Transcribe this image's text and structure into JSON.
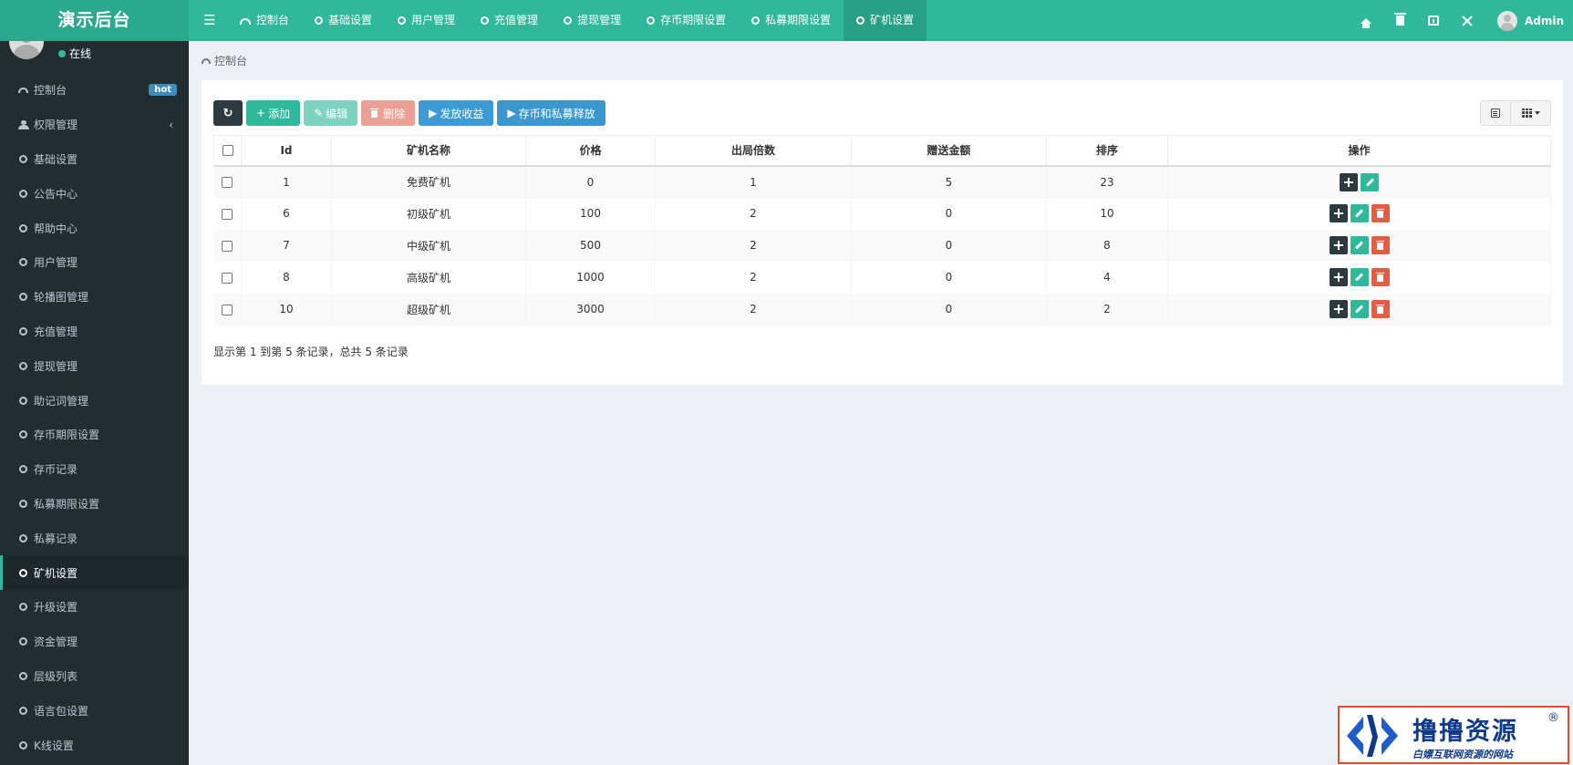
{
  "app": {
    "title": "演示后台"
  },
  "top_nav": [
    {
      "label": "控制台",
      "icon": "dashboard-icon"
    },
    {
      "label": "基础设置",
      "icon": "circle-icon"
    },
    {
      "label": "用户管理",
      "icon": "circle-icon"
    },
    {
      "label": "充值管理",
      "icon": "circle-icon"
    },
    {
      "label": "提现管理",
      "icon": "circle-icon"
    },
    {
      "label": "存币期限设置",
      "icon": "circle-icon"
    },
    {
      "label": "私募期限设置",
      "icon": "circle-icon"
    },
    {
      "label": "矿机设置",
      "icon": "circle-icon",
      "active": true
    }
  ],
  "top_right": {
    "user_name": "Admin"
  },
  "user_panel": {
    "status": "在线"
  },
  "sidebar": {
    "hot_badge": "hot",
    "items": [
      {
        "label": "控制台",
        "icon": "dashboard-icon"
      },
      {
        "label": "权限管理",
        "icon": "users-icon"
      },
      {
        "label": "基础设置",
        "icon": "circle-icon"
      },
      {
        "label": "公告中心",
        "icon": "circle-icon"
      },
      {
        "label": "帮助中心",
        "icon": "circle-icon"
      },
      {
        "label": "用户管理",
        "icon": "circle-icon"
      },
      {
        "label": "轮播图管理",
        "icon": "circle-icon"
      },
      {
        "label": "充值管理",
        "icon": "circle-icon"
      },
      {
        "label": "提现管理",
        "icon": "circle-icon"
      },
      {
        "label": "助记词管理",
        "icon": "circle-icon"
      },
      {
        "label": "存币期限设置",
        "icon": "circle-icon"
      },
      {
        "label": "存币记录",
        "icon": "circle-icon"
      },
      {
        "label": "私募期限设置",
        "icon": "circle-icon"
      },
      {
        "label": "私募记录",
        "icon": "circle-icon"
      },
      {
        "label": "矿机设置",
        "icon": "circle-icon",
        "active": true
      },
      {
        "label": "升级设置",
        "icon": "circle-icon"
      },
      {
        "label": "资金管理",
        "icon": "circle-icon"
      },
      {
        "label": "层级列表",
        "icon": "circle-icon"
      },
      {
        "label": "语言包设置",
        "icon": "circle-icon"
      },
      {
        "label": "K线设置",
        "icon": "circle-icon"
      }
    ]
  },
  "breadcrumb": {
    "label": "控制台"
  },
  "toolbar": {
    "add": "添加",
    "edit": "编辑",
    "delete": "删除",
    "release_income": "发放收益",
    "release_deposit": "存币和私募释放"
  },
  "table": {
    "headers": [
      "Id",
      "矿机名称",
      "价格",
      "出局倍数",
      "赠送金额",
      "排序",
      "操作"
    ],
    "rows": [
      {
        "id": "1",
        "name": "免费矿机",
        "price": "0",
        "multiple": "1",
        "bonus": "5",
        "sort": "23",
        "deletable": false
      },
      {
        "id": "6",
        "name": "初级矿机",
        "price": "100",
        "multiple": "2",
        "bonus": "0",
        "sort": "10",
        "deletable": true
      },
      {
        "id": "7",
        "name": "中级矿机",
        "price": "500",
        "multiple": "2",
        "bonus": "0",
        "sort": "8",
        "deletable": true
      },
      {
        "id": "8",
        "name": "高级矿机",
        "price": "1000",
        "multiple": "2",
        "bonus": "0",
        "sort": "4",
        "deletable": true
      },
      {
        "id": "10",
        "name": "超级矿机",
        "price": "3000",
        "multiple": "2",
        "bonus": "0",
        "sort": "2",
        "deletable": true
      }
    ]
  },
  "summary": "显示第 1 到第 5 条记录，总共 5 条记录",
  "watermark": {
    "title": "撸撸资源",
    "registered": "®",
    "subtitle": "白嫖互联网资源的网站"
  },
  "colors": {
    "brand": "#2fb99a",
    "sidebar_bg": "#222d32",
    "danger": "#e35d43",
    "info": "#3c9ad4"
  }
}
